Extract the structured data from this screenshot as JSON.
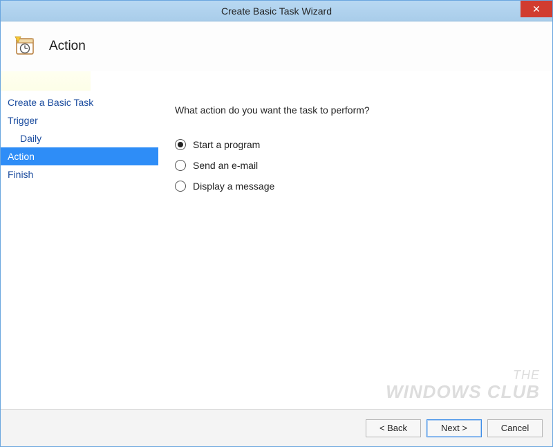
{
  "window": {
    "title": "Create Basic Task Wizard",
    "close_glyph": "✕"
  },
  "header": {
    "title": "Action"
  },
  "sidebar": {
    "items": [
      {
        "label": "Create a Basic Task",
        "indent": false,
        "selected": false
      },
      {
        "label": "Trigger",
        "indent": false,
        "selected": false
      },
      {
        "label": "Daily",
        "indent": true,
        "selected": false
      },
      {
        "label": "Action",
        "indent": false,
        "selected": true
      },
      {
        "label": "Finish",
        "indent": false,
        "selected": false
      }
    ]
  },
  "content": {
    "prompt": "What action do you want the task to perform?",
    "options": [
      {
        "label": "Start a program",
        "checked": true
      },
      {
        "label": "Send an e-mail",
        "checked": false
      },
      {
        "label": "Display a message",
        "checked": false
      }
    ]
  },
  "footer": {
    "back": "< Back",
    "next": "Next >",
    "cancel": "Cancel"
  },
  "watermark": {
    "line1": "THE",
    "line2": "WINDOWS CLUB"
  }
}
